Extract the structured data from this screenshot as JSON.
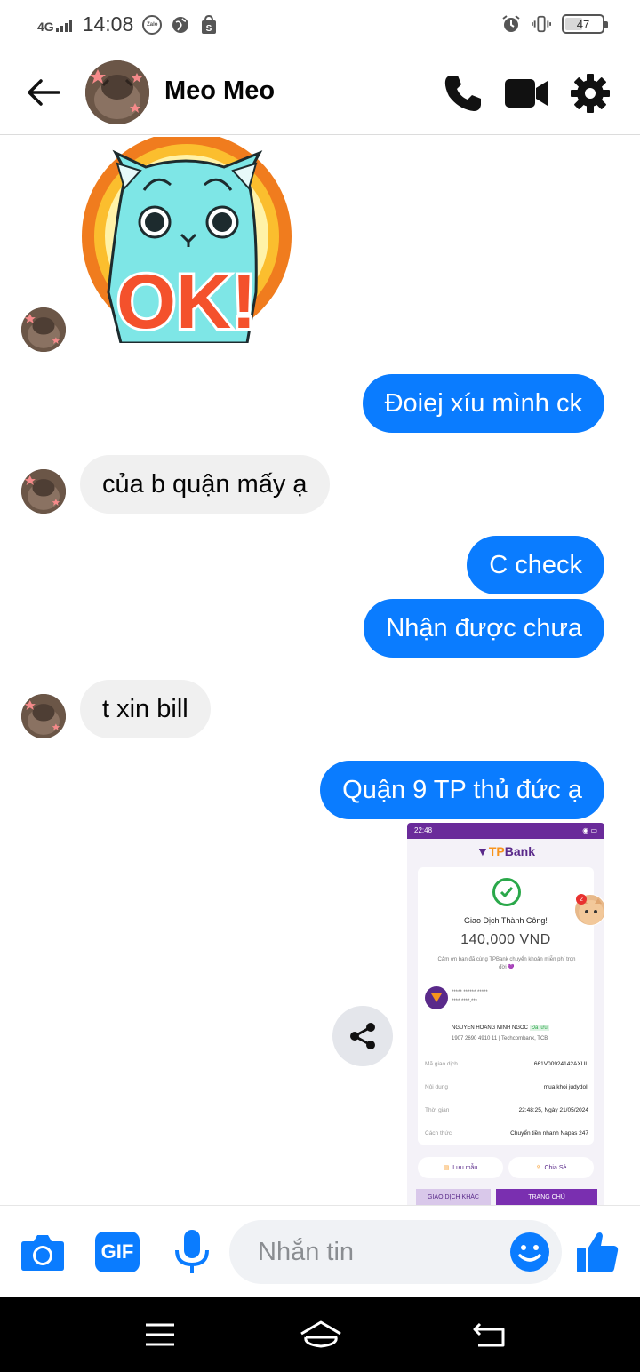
{
  "status_bar": {
    "network": "4G",
    "time": "14:08",
    "app_icons": [
      "zalo-icon",
      "globe-icon",
      "shopee-icon"
    ],
    "zalo_label": "Zalo",
    "battery": "47",
    "battery_level": 0.47
  },
  "header": {
    "contact_name": "Meo Meo",
    "icons": [
      "back-arrow-icon",
      "phone-icon",
      "video-camera-icon",
      "gear-icon"
    ]
  },
  "sticker": {
    "text": "OK!",
    "description_icon": "ok-cat-sticker"
  },
  "messages": [
    {
      "direction": "in",
      "type": "sticker"
    },
    {
      "direction": "out",
      "text": "Đoiej xíu mình ck"
    },
    {
      "direction": "in",
      "text": "của b quận mấy ạ"
    },
    {
      "direction": "out",
      "text": "C check"
    },
    {
      "direction": "out",
      "text": "Nhận được chưa"
    },
    {
      "direction": "in",
      "text": "t xin bill"
    },
    {
      "direction": "out",
      "text": "Quận 9 TP thủ đức ạ"
    },
    {
      "direction": "out",
      "type": "image"
    }
  ],
  "receipt": {
    "status_time": "22:48",
    "bank_prefix": "TP",
    "bank_suffix": "Bank",
    "title": "Giao Dịch Thành Công!",
    "amount": "140,000 VND",
    "thanks": "Cảm ơn bạn đã cùng TPBank chuyển khoản miễn phí trọn đời 💜",
    "masked_line1": "***** ****** *****",
    "masked_line2": "**** ****.***",
    "recipient_name": "NGUYEN HOANG MINH NGOC",
    "saved_tag": "Đã lưu",
    "recipient_account": "1907 2690 4910 11  |  Techcombank, TCB",
    "rows": [
      {
        "key": "Mã giao dịch",
        "value": "661V00924142AXUL"
      },
      {
        "key": "Nội dung",
        "value": "mua khoi judydoll"
      },
      {
        "key": "Thời gian",
        "value": "22:48:25, Ngày 21/05/2024"
      },
      {
        "key": "Cách thức",
        "value": "Chuyển tiền nhanh Napas 247"
      }
    ],
    "save_label": "Lưu mẫu",
    "share_label": "Chia Sẻ",
    "other_tx_label": "GIAO DỊCH KHÁC",
    "home_label": "TRANG CHỦ",
    "notif_count": "2"
  },
  "composer": {
    "placeholder": "Nhắn tin",
    "gif_label": "GIF",
    "icons": [
      "camera-icon",
      "gif-icon",
      "microphone-icon",
      "emoji-icon",
      "thumbs-up-icon"
    ]
  },
  "colors": {
    "accent": "#0a7cff",
    "incoming_bubble": "#f0f0f0",
    "tpbank_purple": "#6a2b9a",
    "tpbank_orange": "#f7941d"
  }
}
